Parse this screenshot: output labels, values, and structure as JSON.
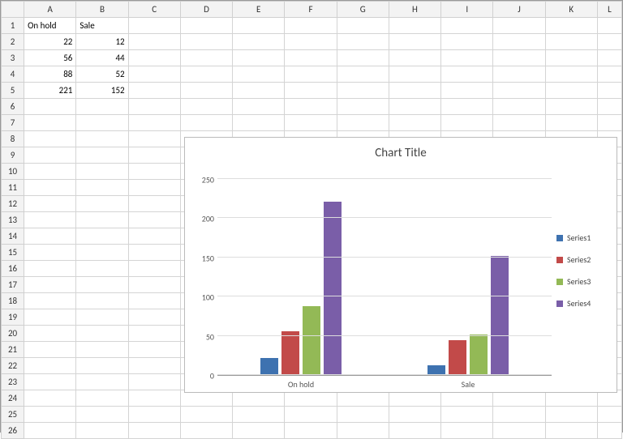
{
  "columns": [
    "A",
    "B",
    "C",
    "D",
    "E",
    "F",
    "G",
    "H",
    "I",
    "J",
    "K",
    "L"
  ],
  "selected_column": "G",
  "rows": 26,
  "cells": {
    "A1": "On hold",
    "B1": "Sale",
    "A2": "22",
    "B2": "12",
    "A3": "56",
    "B3": "44",
    "A4": "88",
    "B4": "52",
    "A5": "221",
    "B5": "152"
  },
  "chart_title": "Chart Title",
  "legend_labels": [
    "Series1",
    "Series2",
    "Series3",
    "Series4"
  ],
  "series_colors": [
    "#3e72b0",
    "#c24a49",
    "#93b956",
    "#7a5ea8"
  ],
  "y_ticks": [
    "0",
    "50",
    "100",
    "150",
    "200",
    "250"
  ],
  "x_categories": [
    "On hold",
    "Sale"
  ],
  "chart_data": {
    "type": "bar",
    "title": "Chart Title",
    "xlabel": "",
    "ylabel": "",
    "ylim": [
      0,
      250
    ],
    "categories": [
      "On hold",
      "Sale"
    ],
    "series": [
      {
        "name": "Series1",
        "values": [
          22,
          12
        ]
      },
      {
        "name": "Series2",
        "values": [
          56,
          44
        ]
      },
      {
        "name": "Series3",
        "values": [
          88,
          52
        ]
      },
      {
        "name": "Series4",
        "values": [
          221,
          152
        ]
      }
    ],
    "legend_position": "right",
    "grid": true
  }
}
